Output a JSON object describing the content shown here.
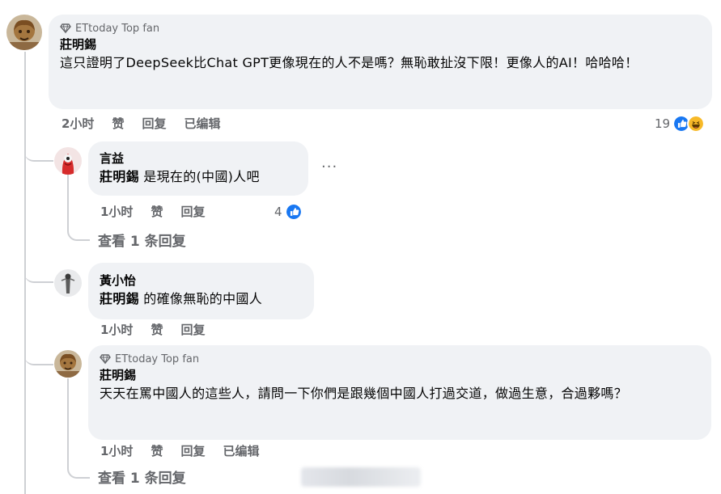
{
  "colors": {
    "bubble": "#f0f2f5",
    "meta": "#65676b",
    "like_blue": "#1877f2",
    "haha_yellow": "#f7b928",
    "thread_line": "#ced0d4"
  },
  "comments": [
    {
      "badge": "ETtoday Top fan",
      "badge_icon": "diamond-icon",
      "author": "莊明錫",
      "text": "這只證明了DeepSeek比Chat GPT更像現在的人不是嗎？無恥敢扯沒下限！更像人的AI！哈哈哈！",
      "time": "2小时",
      "like": "赞",
      "reply": "回复",
      "edited": "已编辑",
      "reaction_count": "19",
      "reaction_icons": [
        "like-reaction-icon",
        "haha-reaction-icon"
      ]
    }
  ],
  "replies": [
    {
      "author": "言益",
      "mention": "莊明錫",
      "text": "是現在的(中國)人吧",
      "time": "1小时",
      "like": "赞",
      "reply": "回复",
      "reaction_count": "4",
      "reaction_icons": [
        "like-reaction-icon"
      ],
      "more": "···",
      "view_replies": "查看 1 条回复"
    },
    {
      "author": "黃小怡",
      "mention": "莊明錫",
      "text": "的確像無恥的中國人",
      "time": "1小时",
      "like": "赞",
      "reply": "回复"
    },
    {
      "badge": "ETtoday Top fan",
      "badge_icon": "diamond-icon",
      "author": "莊明錫",
      "text": "天天在罵中國人的這些人，請問一下你們是跟幾個中國人打過交道，做過生意，合過夥嗎？",
      "time": "1小时",
      "like": "赞",
      "reply": "回复",
      "edited": "已编辑",
      "view_replies": "查看 1 条回复"
    }
  ]
}
